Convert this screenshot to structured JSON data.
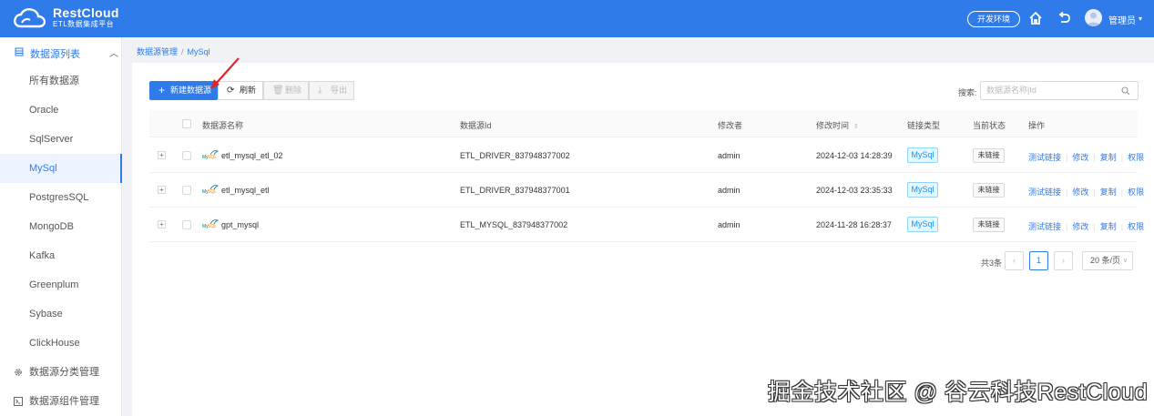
{
  "header": {
    "brand_name": "RestCloud",
    "brand_sub": "ETL数据集成平台",
    "env_button": "开发环境",
    "user_name": "管理员",
    "caret": "▾",
    "bg_color": "#2f7bea"
  },
  "sidebar": {
    "section_title": "数据源列表",
    "section_chevron": "︿",
    "items": [
      {
        "label": "所有数据源"
      },
      {
        "label": "Oracle"
      },
      {
        "label": "SqlServer"
      },
      {
        "label": "MySql",
        "active": true
      },
      {
        "label": "PostgresSQL"
      },
      {
        "label": "MongoDB"
      },
      {
        "label": "Kafka"
      },
      {
        "label": "Greenplum"
      },
      {
        "label": "Sybase"
      },
      {
        "label": "ClickHouse"
      }
    ],
    "groups": [
      {
        "label": "数据源分类管理",
        "icon": "gear-icon"
      },
      {
        "label": "数据源组件管理",
        "icon": "terminal-icon"
      }
    ]
  },
  "breadcrumb": {
    "parent": "数据源管理",
    "separator": "/",
    "current": "MySql"
  },
  "toolbar": {
    "new_label": "新建数据源",
    "refresh_label": "刷新",
    "delete_label": "删除",
    "export_label": "导出",
    "search_label": "搜索:",
    "search_placeholder": "数据源名称|Id"
  },
  "table": {
    "headers": {
      "name": "数据源名称",
      "id": "数据源Id",
      "modifier": "修改者",
      "modified_time": "修改时间",
      "link_type": "链接类型",
      "status": "当前状态",
      "actions": "操作"
    },
    "sort_glyph": "⇕",
    "rows": [
      {
        "name": "etl_mysql_etl_02",
        "id": "ETL_DRIVER_837948377002",
        "modifier": "admin",
        "time": "2024-12-03 14:28:39",
        "type": "MySql",
        "status": "未链接"
      },
      {
        "name": "etl_mysql_etl",
        "id": "ETL_DRIVER_837948377001",
        "modifier": "admin",
        "time": "2024-12-03 23:35:33",
        "type": "MySql",
        "status": "未链接"
      },
      {
        "name": "gpt_mysql",
        "id": "ETL_MYSQL_837948377002",
        "modifier": "admin",
        "time": "2024-11-28 16:28:37",
        "type": "MySql",
        "status": "未链接"
      }
    ],
    "row_actions": [
      "测试链接",
      "修改",
      "复制",
      "权限"
    ],
    "expand_glyph": "+"
  },
  "pagination": {
    "total": "共3条",
    "prev": "‹",
    "current_page": "1",
    "next": "›",
    "page_size": "20 条/页",
    "dropdown": "∨"
  },
  "watermark": "掘金技术社区 @ 谷云科技RestCloud"
}
